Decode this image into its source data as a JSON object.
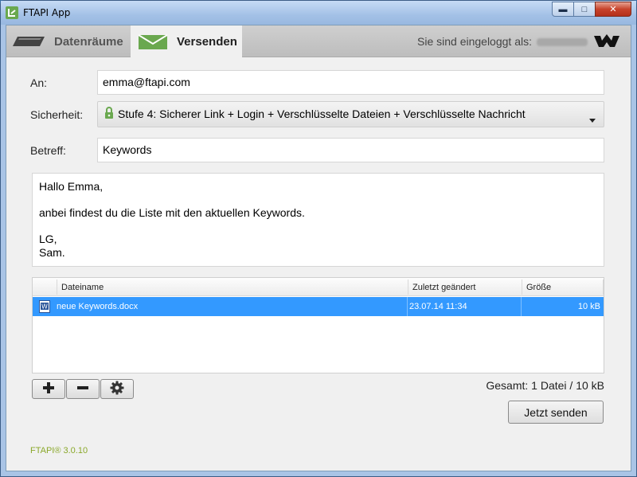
{
  "window": {
    "title": "FTAPI App",
    "minimize": "▬",
    "maximize": "□",
    "close": "✕"
  },
  "tabs": [
    {
      "label": "Datenräume",
      "icon": "folder-icon"
    },
    {
      "label": "Versenden",
      "icon": "envelope-icon"
    }
  ],
  "header": {
    "login_text": "Sie sind eingeloggt als:",
    "logo_icon": "ftapi-logo-icon"
  },
  "form": {
    "to_label": "An:",
    "to_value": "emma@ftapi.com",
    "security_label": "Sicherheit:",
    "security_value": "Stufe 4: Sicherer Link + Login + Verschlüsselte Dateien + Verschlüsselte Nachricht",
    "subject_label": "Betreff:",
    "subject_value": "Keywords"
  },
  "message": {
    "line1": "Hallo Emma,",
    "line2": "anbei findest du die Liste mit den aktuellen Keywords.",
    "line3": "LG,",
    "line4": "Sam."
  },
  "files": {
    "columns": [
      "Dateiname",
      "Zuletzt geändert",
      "Größe"
    ],
    "rows": [
      {
        "name": "neue Keywords.docx",
        "modified": "23.07.14 11:34",
        "size": "10 kB"
      }
    ]
  },
  "summary": "Gesamt: 1 Datei / 10 kB",
  "send_label": "Jetzt senden",
  "version": "FTAPI® 3.0.10",
  "colors": {
    "accent_green": "#6aa84f",
    "selection_blue": "#3399ff"
  }
}
